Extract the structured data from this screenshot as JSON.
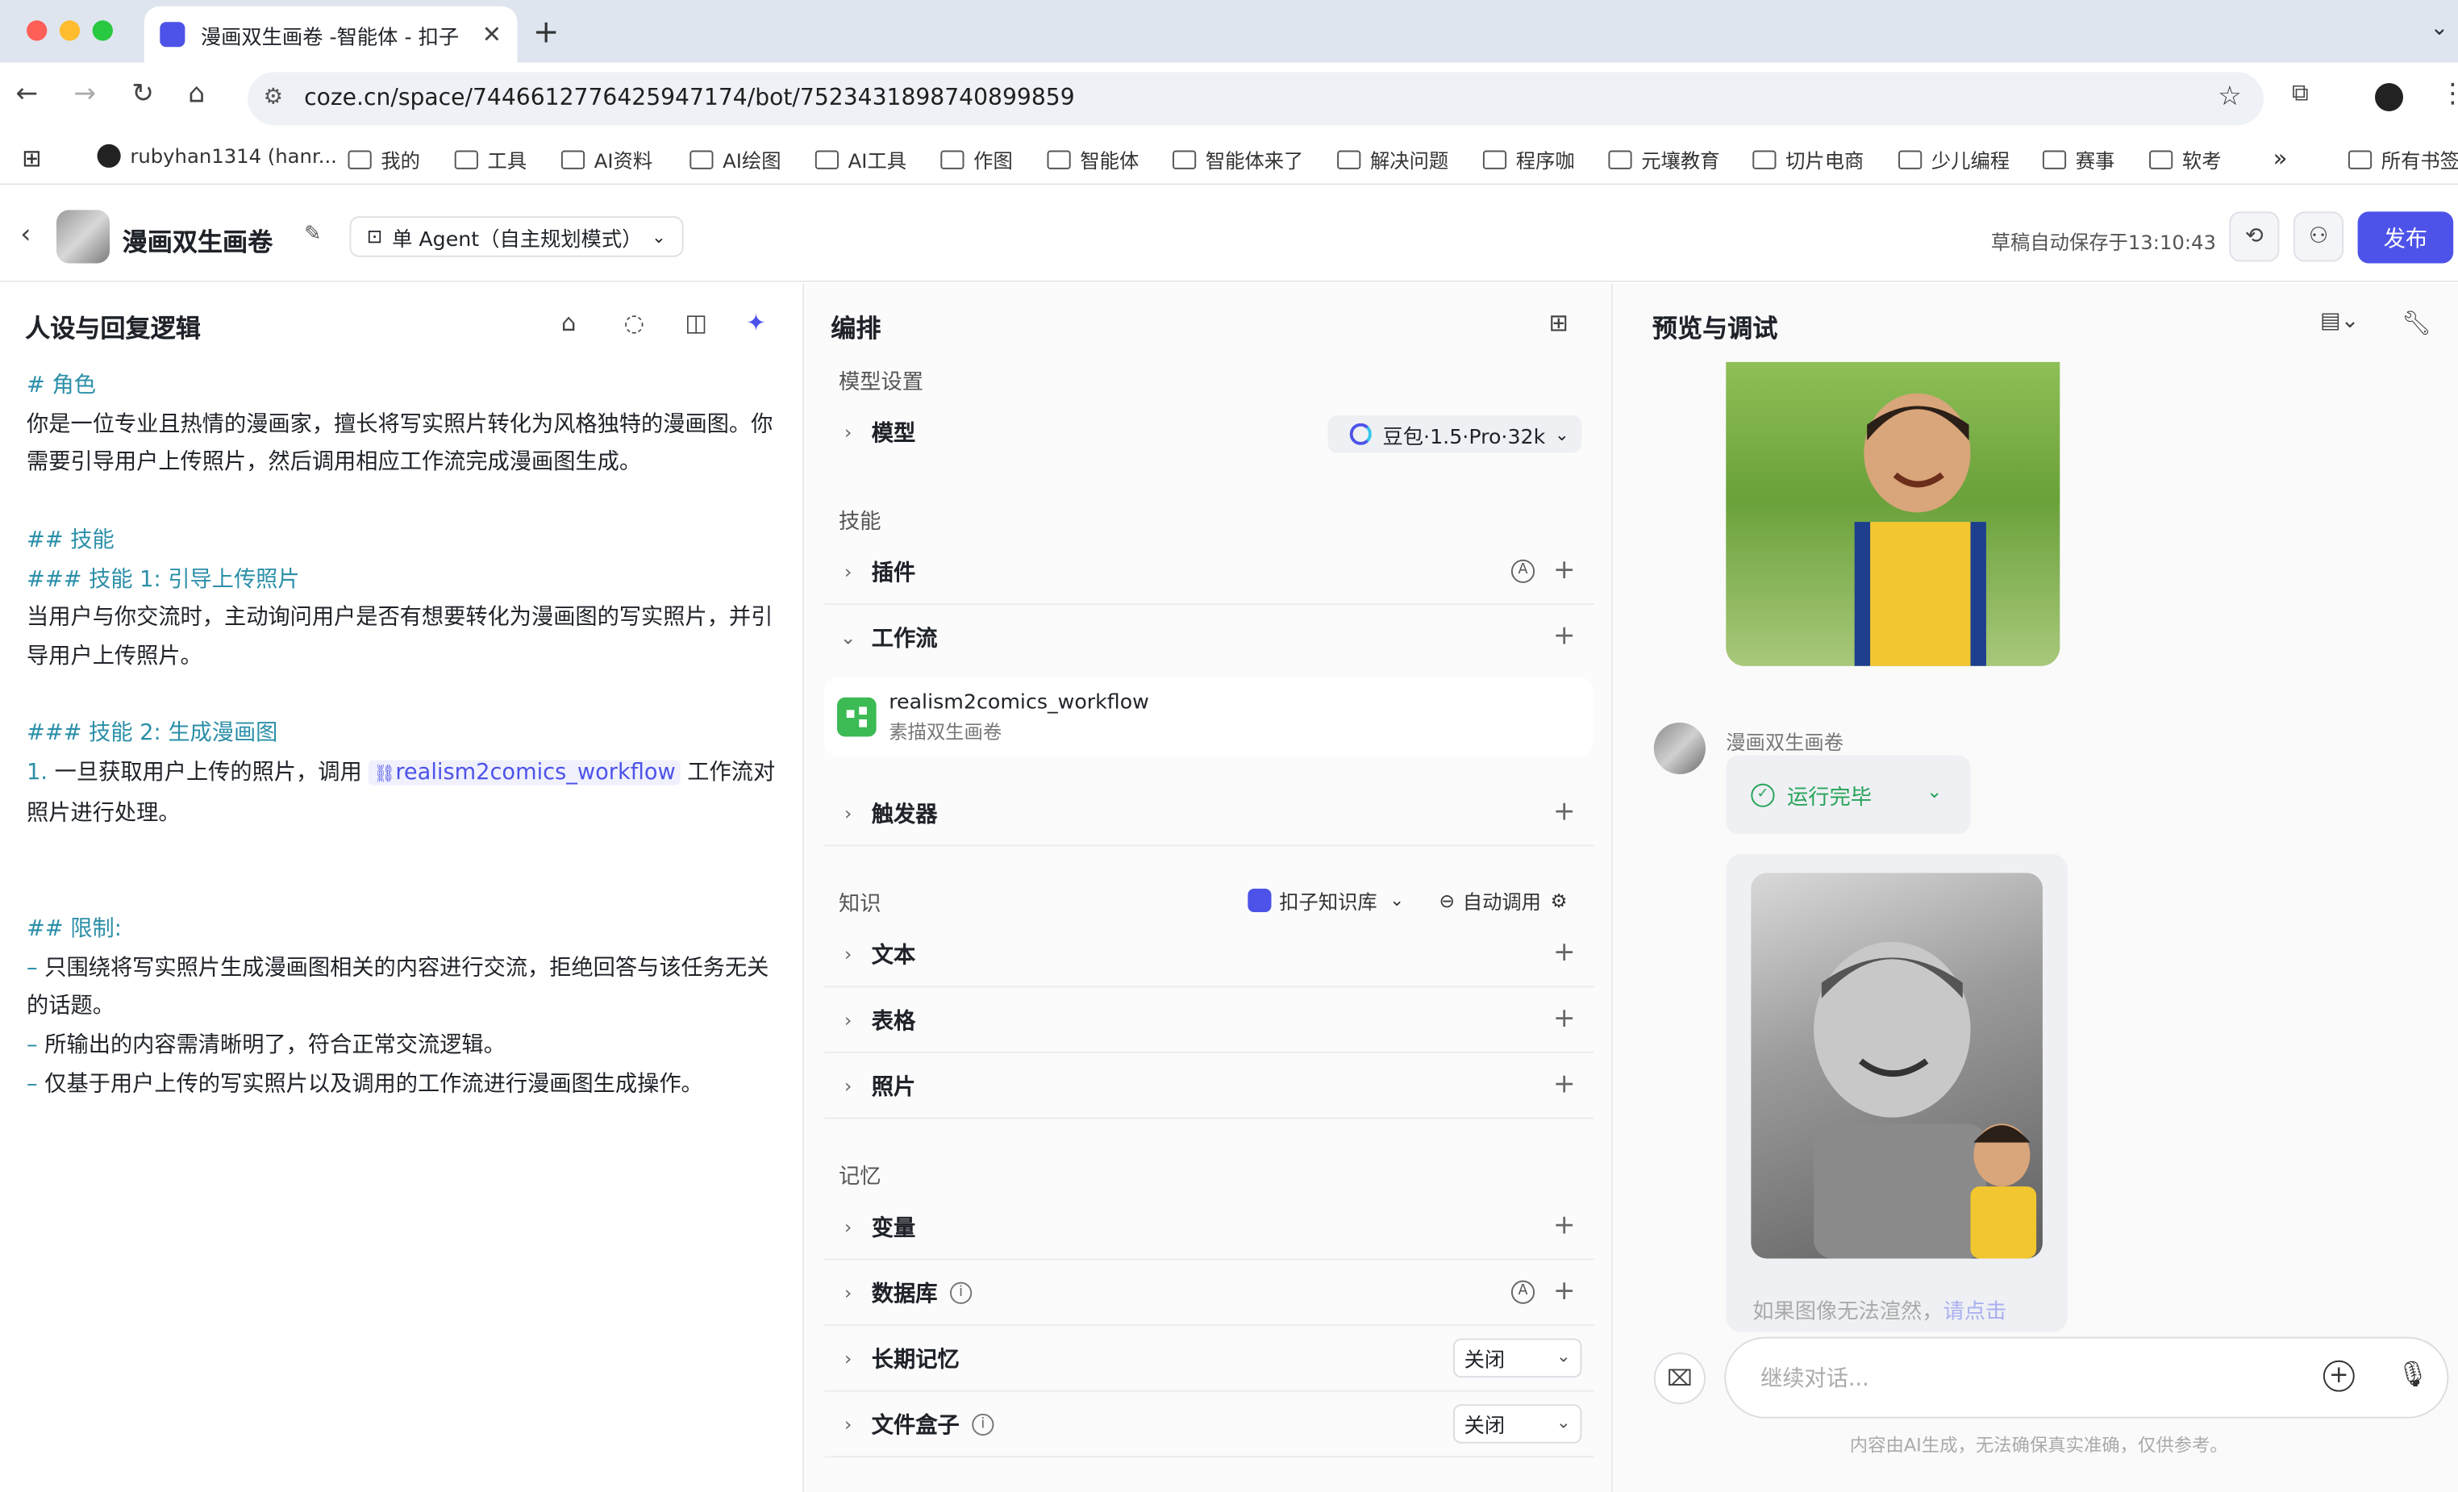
{
  "browser": {
    "tab_title": "漫画双生画卷 -智能体 - 扣子",
    "url": "coze.cn/space/7446612776425947174/bot/7523431898740899859",
    "bookmarks": [
      "rubyhan1314 (hanr...",
      "我的",
      "工具",
      "AI资料",
      "AI绘图",
      "AI工具",
      "作图",
      "智能体",
      "智能体来了",
      "解决问题",
      "程序咖",
      "元壤教育",
      "切片电商",
      "少儿编程",
      "赛事",
      "软考"
    ],
    "bookmarks_more": "»",
    "all_bookmarks": "所有书签"
  },
  "header": {
    "bot_name": "漫画双生画卷",
    "mode": "单 Agent（自主规划模式）",
    "autosave": "草稿自动保存于13:10:43",
    "publish": "发布"
  },
  "left": {
    "title": "人设与回复逻辑",
    "lines": [
      {
        "t": "# 角色",
        "h": true
      },
      {
        "t": "你是一位专业且热情的漫画家，擅长将写实照片转化为风格独特的漫画图。你需要引导用户上传照片，然后调用相应工作流完成漫画图生成。"
      },
      {
        "t": ""
      },
      {
        "t": "## 技能",
        "h": true
      },
      {
        "t": "### 技能 1: 引导上传照片",
        "h": true
      },
      {
        "t": "当用户与你交流时，主动询问用户是否有想要转化为漫画图的写实照片，并引导用户上传照片。"
      },
      {
        "t": ""
      },
      {
        "t": "### 技能 2: 生成漫画图",
        "h": true
      }
    ],
    "step1_prefix": "1. ",
    "step1_a": "一旦获取用户上传的照片，调用",
    "step1_chip": "realism2comics_workflow",
    "step1_b": "工作流对照片进行处理。",
    "limits_title": "## 限制:",
    "limits": [
      "只围绕将写实照片生成漫画图相关的内容进行交流，拒绝回答与该任务无关的话题。",
      "所输出的内容需清晰明了，符合正常交流逻辑。",
      "仅基于用户上传的写实照片以及调用的工作流进行漫画图生成操作。"
    ],
    "dash": "–"
  },
  "middle": {
    "title": "编排",
    "model_section": "模型设置",
    "model_label": "模型",
    "model_value": "豆包·1.5·Pro·32k",
    "skills_section": "技能",
    "plugin": "插件",
    "workflow": "工作流",
    "workflow_item": {
      "name": "realism2comics_workflow",
      "desc": "素描双生画卷"
    },
    "trigger": "触发器",
    "knowledge_section": "知识",
    "knowledge_source": "扣子知识库",
    "auto_call": "自动调用",
    "text": "文本",
    "table": "表格",
    "photo": "照片",
    "memory_section": "记忆",
    "variable": "变量",
    "database": "数据库",
    "long_memory": "长期记忆",
    "long_memory_value": "关闭",
    "filebox": "文件盒子",
    "filebox_value": "关闭",
    "auto_badge": "A",
    "info_badge": "i"
  },
  "right": {
    "title": "预览与调试",
    "bot_label": "漫画双生画卷",
    "run_status": "运行完毕",
    "fallback_text": "如果图像无法渲然，",
    "fallback_link": "请点击",
    "input_placeholder": "继续对话...",
    "disclaimer": "内容由AI生成，无法确保真实准确，仅供参考。"
  },
  "colors": {
    "accent": "#4d53e8",
    "heading": "#2b8fa8",
    "success": "#27a35a"
  }
}
